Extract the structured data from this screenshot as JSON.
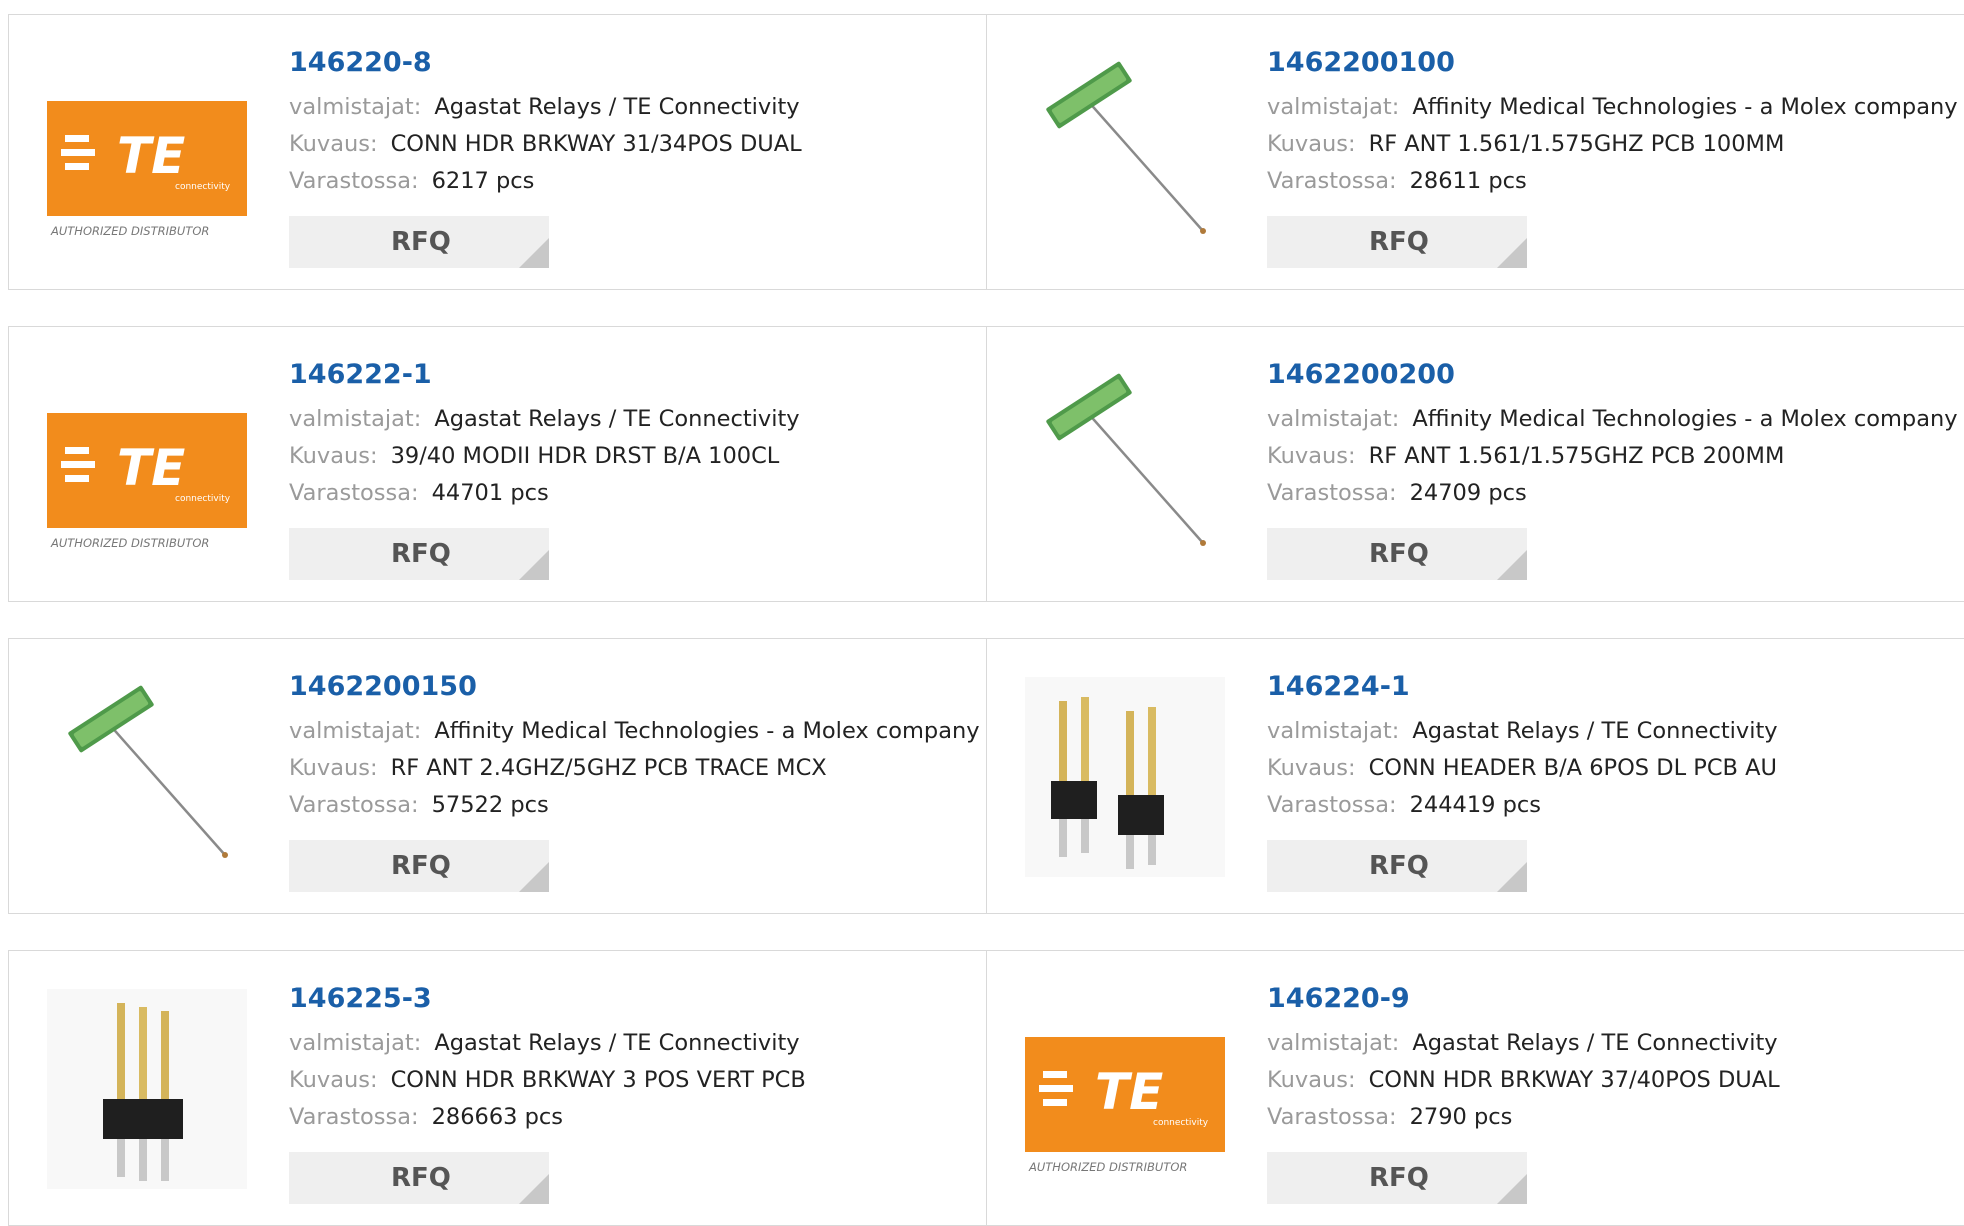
{
  "labels": {
    "manufacturer": "valmistajat:",
    "description": "Kuvaus:",
    "stock": "Varastossa:",
    "rfq": "RFQ",
    "te_distributor": "AUTHORIZED DISTRIBUTOR",
    "te_sub": "connectivity"
  },
  "products": [
    {
      "part": "146220-8",
      "manufacturer": "Agastat Relays / TE Connectivity",
      "description": "CONN HDR BRKWAY 31/34POS DUAL",
      "stock": "6217 pcs",
      "image": "te-logo"
    },
    {
      "part": "1462200100",
      "manufacturer": "Affinity Medical Technologies - a Molex company",
      "description": "RF ANT 1.561/1.575GHZ PCB 100MM",
      "stock": "28611 pcs",
      "image": "antenna"
    },
    {
      "part": "146222-1",
      "manufacturer": "Agastat Relays / TE Connectivity",
      "description": "39/40 MODII HDR DRST B/A 100CL",
      "stock": "44701 pcs",
      "image": "te-logo"
    },
    {
      "part": "1462200200",
      "manufacturer": "Affinity Medical Technologies - a Molex company",
      "description": "RF ANT 1.561/1.575GHZ PCB 200MM",
      "stock": "24709 pcs",
      "image": "antenna"
    },
    {
      "part": "1462200150",
      "manufacturer": "Affinity Medical Technologies - a Molex company",
      "description": "RF ANT 2.4GHZ/5GHZ PCB TRACE MCX",
      "stock": "57522 pcs",
      "image": "antenna"
    },
    {
      "part": "146224-1",
      "manufacturer": "Agastat Relays / TE Connectivity",
      "description": "CONN HEADER B/A 6POS DL PCB AU",
      "stock": "244419 pcs",
      "image": "header-6pin"
    },
    {
      "part": "146225-3",
      "manufacturer": "Agastat Relays / TE Connectivity",
      "description": "CONN HDR BRKWAY 3 POS VERT PCB",
      "stock": "286663 pcs",
      "image": "header-3pin"
    },
    {
      "part": "146220-9",
      "manufacturer": "Agastat Relays / TE Connectivity",
      "description": "CONN HDR BRKWAY 37/40POS DUAL",
      "stock": "2790 pcs",
      "image": "te-logo"
    }
  ]
}
